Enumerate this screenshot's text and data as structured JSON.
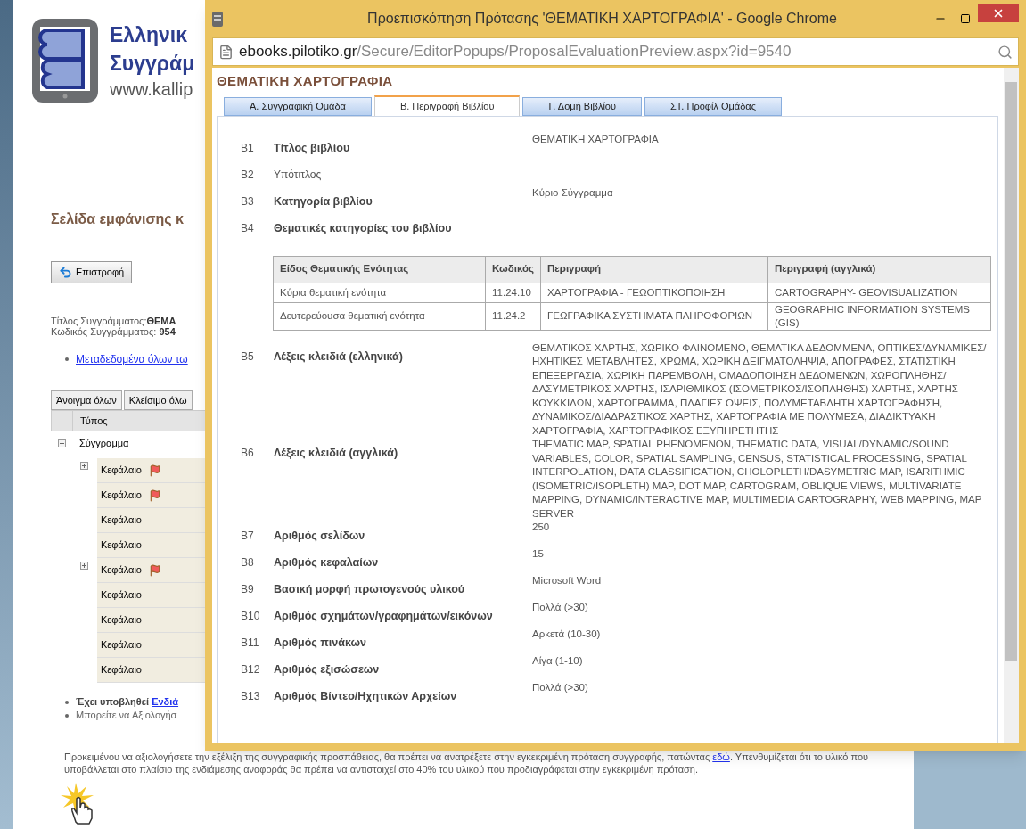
{
  "back_page": {
    "logo_lines": [
      "Ελληνικ",
      "Συγγράμ"
    ],
    "site_url": "www.kallip",
    "page_title": "Σελίδα εμφάνισης κ",
    "back_button": "Επιστροφή",
    "info": [
      {
        "label": "Τίτλος Συγγράμματος:",
        "value": "ΘΕΜΑ"
      },
      {
        "label": "Κωδικός Συγγράμματος: ",
        "value": "954"
      }
    ],
    "metadata_link": "Μεταδεδομένα όλων τω",
    "tree_buttons": [
      "Άνοιγμα όλων",
      "Κλείσιμο όλω"
    ],
    "tree_header": "Τύπος",
    "tree": {
      "label": "Σύγγραμμα",
      "expanded": true,
      "children": [
        {
          "label": "Κεφάλαιο",
          "flagged": true,
          "expander": true
        },
        {
          "label": "Κεφάλαιο",
          "flagged": true,
          "expander": false
        },
        {
          "label": "Κεφάλαιο",
          "flagged": false,
          "expander": false
        },
        {
          "label": "Κεφάλαιο",
          "flagged": false,
          "expander": false
        },
        {
          "label": "Κεφάλαιο",
          "flagged": true,
          "expander": true
        },
        {
          "label": "Κεφάλαιο",
          "flagged": false,
          "expander": false
        },
        {
          "label": "Κεφάλαιο",
          "flagged": false,
          "expander": false
        },
        {
          "label": "Κεφάλαιο",
          "flagged": false,
          "expander": false
        },
        {
          "label": "Κεφάλαιο",
          "flagged": false,
          "expander": false
        }
      ]
    },
    "bullets": [
      {
        "bold": "Έχει υποβληθεί ",
        "link": "Ενδιά"
      },
      {
        "text": "Μπορείτε να Αξιολογήσ"
      }
    ],
    "paragraph": {
      "before": "Προκειμένου να αξιολογήσετε την εξέλιξη της συγγραφικής προσπάθειας, θα πρέπει να ανατρέξετε στην εγκεκριμένη πρόταση συγγραφής, πατώντας ",
      "link": "εδώ",
      "after": ". Υπενθυμίζεται ότι το υλικό που υποβάλλεται στο πλαίσιο της ενδιάμεσης αναφοράς θα πρέπει να αντιστοιχεί στο 40% του υλικού που προδιαγράφεται στην εγκεκριμένη πρόταση."
    }
  },
  "popup": {
    "title": "Προεπισκόπηση Πρότασης 'ΘΕΜΑΤΙΚΗ ΧΑΡΤΟΓΡΑΦΙΑ' - Google Chrome",
    "url_host": "ebooks.pilotiko.gr",
    "url_path": "/Secure/EditorPopups/ProposalEvaluationPreview.aspx?id=9540",
    "heading": "ΘΕΜΑΤΙΚΗ ΧΑΡΤΟΓΡΑΦΙΑ",
    "tabs": [
      {
        "label": "Α. Συγγραφική Ομάδα",
        "selected": false
      },
      {
        "label": "Β. Περιγραφή Βιβλίου",
        "selected": true
      },
      {
        "label": "Γ. Δομή Βιβλίου",
        "selected": false
      },
      {
        "label": "ΣΤ. Προφίλ Ομάδας",
        "selected": false
      }
    ],
    "fields": [
      {
        "code": "B1",
        "label": "Τίτλος βιβλίου",
        "emphasized": true,
        "value": "ΘΕΜΑΤΙΚΗ ΧΑΡΤΟΓΡΑΦΙΑ"
      },
      {
        "code": "B2",
        "label": "Υπότιτλος",
        "emphasized": false
      },
      {
        "code": "B3",
        "label": "Κατηγορία βιβλίου",
        "emphasized": true,
        "value": "Κύριο Σύγγραμμα"
      },
      {
        "code": "B4",
        "label": "Θεματικές κατηγορίες του βιβλίου",
        "emphasized": true,
        "table": {
          "columns": [
            "Είδος Θεματικής Ενότητας",
            "Κωδικός",
            "Περιγραφή",
            "Περιγραφή (αγγλικά)"
          ],
          "rows": [
            [
              "Κύρια θεματική ενότητα",
              "11.24.10",
              "ΧΑΡΤΟΓΡΑΦΙΑ - ΓΕΩΟΠΤΙΚΟΠΟΙΗΣΗ",
              "CARTOGRAPHY- GEOVISUALIZATION"
            ],
            [
              "Δευτερεύουσα θεματική ενότητα",
              "11.24.2",
              "ΓΕΩΓΡΑΦΙΚΑ ΣΥΣΤΗΜΑΤΑ ΠΛΗΡΟΦΟΡΙΩΝ",
              "GEOGRAPHIC INFORMATION SYSTEMS (GIS)"
            ]
          ]
        }
      },
      {
        "code": "B5",
        "label": "Λέξεις κλειδιά (ελληνικά)",
        "emphasized": true,
        "value": "ΘΕΜΑΤΙΚΟΣ ΧΑΡΤΗΣ, ΧΩΡΙΚΟ ΦΑΙΝΟΜΕΝΟ, ΘΕΜΑΤΙΚΑ ΔΕΔΟΜΜΕΝΑ, ΟΠΤΙΚΕΣ/ΔΥΝΑΜΙΚΕΣ/ΗΧΗΤΙΚΕΣ ΜΕΤΑΒΛΗΤΕΣ, ΧΡΩΜΑ, ΧΩΡΙΚΗ ΔΕΙΓΜΑΤΟΛΗΨΙΑ, ΑΠΟΓΡΑΦΕΣ, ΣΤΑΤΙΣΤΙΚΗ ΕΠΕΞΕΡΓΑΣΙΑ, ΧΩΡΙΚΗ ΠΑΡΕΜΒΟΛΗ, ΟΜΑΔΟΠΟΙΗΣΗ ΔΕΔΟΜΕΝΩΝ, ΧΩΡΟΠΛΗΘΗΣ/ΔΑΣΥΜΕΤΡΙΚΟΣ ΧΑΡΤΗΣ, ΙΣΑΡΙΘΜΙΚΟΣ (ΙΣΟΜΕΤΡΙΚΟΣ/ΙΣΟΠΛΗΘΗΣ) ΧΑΡΤΗΣ, ΧΑΡΤΗΣ ΚΟΥΚΚΙΔΩΝ, ΧΑΡΤΟΓΡΑΜΜΑ, ΠΛΑΓΙΕΣ ΟΨΕΙΣ, ΠΟΛΥΜΕΤΑΒΛΗΤΗ ΧΑΡΤΟΓΡΑΦΗΣΗ, ΔΥΝΑΜΙΚΟΣ/ΔΙΑΔΡΑΣΤΙΚΟΣ ΧΑΡΤΗΣ, ΧΑΡΤΟΓΡΑΦΙΑ ΜΕ ΠΟΛΥΜΕΣΑ, ΔΙΑΔΙΚΤΥΑΚΗ ΧΑΡΤΟΓΡΑΦΙΑ, ΧΑΡΤΟΓΡΑΦΙΚΟΣ ΕΞΥΠΗΡΕΤΗΤΗΣ"
      },
      {
        "code": "B6",
        "label": "Λέξεις κλειδιά (αγγλικά)",
        "emphasized": true,
        "value": "THEMATIC MAP, SPATIAL PHENOMENON, THEMATIC DATA, VISUAL/DYNAMIC/SOUND VARIABLES, COLOR, SPATIAL SAMPLING, CENSUS, STATISTICAL PROCESSING, SPATIAL INTERPOLATION, DATA CLASSIFICATION, CHOLOPLETH/DASYMETRIC MAP, ISARITHMIC (ISOMETRIC/ISOPLETH) MAP, DOT MAP, CARTOGRAM, OBLIQUE VIEWS, MULTIVARIATE MAPPING, DYNAMIC/INTERACTIVE MAP, MULTIMEDIA CARTOGRAPHY, WEB MAPPING, MAP SERVER"
      },
      {
        "code": "B7",
        "label": "Αριθμός σελίδων",
        "emphasized": true,
        "value": "250"
      },
      {
        "code": "B8",
        "label": "Αριθμός κεφαλαίων",
        "emphasized": true,
        "value": "15"
      },
      {
        "code": "B9",
        "label": "Βασική μορφή πρωτογενούς υλικού",
        "emphasized": true,
        "value": "Microsoft Word"
      },
      {
        "code": "B10",
        "label": "Αριθμός σχημάτων/γραφημάτων/εικόνων",
        "emphasized": true,
        "value": "Πολλά (>30)"
      },
      {
        "code": "B11",
        "label": "Αριθμός πινάκων",
        "emphasized": true,
        "value": "Αρκετά (10-30)"
      },
      {
        "code": "B12",
        "label": "Αριθμός εξισώσεων",
        "emphasized": true,
        "value": "Λίγα (1-10)"
      },
      {
        "code": "B13",
        "label": "Αριθμός Βίντεο/Ηχητικών Αρχείων",
        "emphasized": true,
        "value": "Πολλά (>30)"
      }
    ]
  }
}
